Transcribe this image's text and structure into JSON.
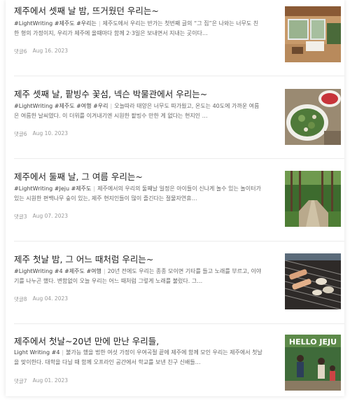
{
  "posts": [
    {
      "title": "제주에서 셋째 날 밤, 뜨거웠던 우리는~",
      "tags": "#LightWriting #제주도 #우리는",
      "excerpt": "제주도에서 우리는 반가는 첫번째 글의 “그 집”은 나와는 너무도 친한 형의 가정이지, 우리가 제주에 올때마다 함께 2·3일은 보내면서 지내는 곳이다…",
      "comments": "댓글6",
      "date": "Aug 16. 2023",
      "thumb_icon": "house-interior-photo"
    },
    {
      "title": "제주 셋째 날, 팥빙수 꽃섬, 넥슨 박물관에서 우리는~",
      "tags": "#LightWriting #제주도 #여행 #우리",
      "excerpt": "오늘따라 태양은 너무도 따가웠고, 온도는 40도에 가까운 여름은 여름한 날씨였다. 이 더위를 이겨내기엔 시원한 팥빙수 만한 게 없다는 현지인 …",
      "comments": "댓글6",
      "date": "Aug 10. 2023",
      "thumb_icon": "food-salad-photo"
    },
    {
      "title": "제주에서 둘째 날, 그 여름 우리는~",
      "tags": "#LightWriting #Jeju #제주도",
      "excerpt": "제주에서의 우리의 둘째날 일정은 아이들이 신나게 놀수 있는 놀이터가 있는 시원한 편백나무 숲이 있는, 제주 현지인들이 많이 즐긴다는 절물자연휴…",
      "comments": "댓글3",
      "date": "Aug 07. 2023",
      "thumb_icon": "forest-path-photo"
    },
    {
      "title": "제주 첫날 밤, 그 어느 때처럼 우리는~",
      "tags": "#LightWriting #4 #제주도 #여행",
      "excerpt": "20년 전에도 우리는 종종 모이면 기타를 들고 노래를 부르고, 이야기를 나누곤 했다. 변함없이 오늘 우리는 어느 때처럼 그렇게 노래를 불렀다. 그…",
      "comments": "댓글8",
      "date": "Aug 04. 2023",
      "thumb_icon": "barbecue-grill-photo"
    },
    {
      "title": "제주에서 첫날~20년 만에 만난 우리들,",
      "tags": "Light Writing #4",
      "excerpt": "불가능 했을 법한 여섯 가정이 우여곡절 끝에 제주에 함께 모인 우리는 제주에서 첫날을 맞이한다. 대학을 다닐 때 함께 오프라인 공간에서 학교를 보낸 친구 신배들…",
      "comments": "댓글7",
      "date": "Aug 01. 2023",
      "thumb_icon": "hello-jeju-photo",
      "thumb_text": "HELLO JEJU"
    }
  ],
  "separator": "|"
}
